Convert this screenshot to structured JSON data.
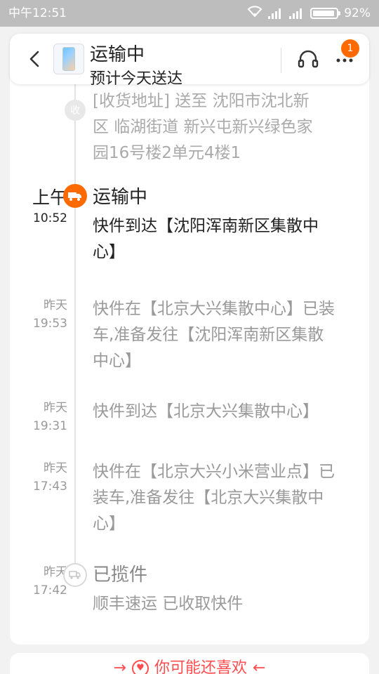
{
  "status_bar": {
    "time": "中午12:51",
    "battery": "92%",
    "battery_level": 0.92
  },
  "header": {
    "title": "运输中",
    "subtitle": "预计今天送达",
    "badge_count": "1",
    "icons": [
      "chevron-left-icon",
      "headset-icon",
      "more-icon"
    ]
  },
  "timeline": {
    "address_fragment": "[收货地址]送至 沈阳市沈北新区 临湖街道 新兴屯新兴绿色家园16号楼2单元4楼1",
    "address_line_top": "[收货地址] 送至 沈阳市沈北新",
    "address_line_2": "区 临湖街道  新兴屯新兴绿色家",
    "address_line_3": "园16号楼2单元4楼1",
    "events": [
      {
        "day": "上午",
        "time": "10:52",
        "title": "运输中",
        "desc_line1": "快件到达【沈阳浑南新区集散中",
        "desc_line2": "心】"
      },
      {
        "day": "昨天",
        "time": "19:53",
        "desc_line1": "快件在【北京大兴集散中心】已装",
        "desc_line2": "车,准备发往【沈阳浑南新区集散",
        "desc_line3": "中心】"
      },
      {
        "day": "昨天",
        "time": "19:31",
        "desc_line1": "快件到达【北京大兴集散中心】"
      },
      {
        "day": "昨天",
        "time": "17:43",
        "desc_line1": "快件在【北京大兴小米营业点】已",
        "desc_line2": "装车,准备发往【北京大兴集散中",
        "desc_line3": "心】"
      },
      {
        "day": "昨天",
        "time": "17:42",
        "title": "已揽件",
        "desc_line1": "顺丰速运 已收取快件"
      }
    ],
    "status_colors": {
      "active": "#ff6a00",
      "inactive": "#cccccc"
    }
  },
  "recommend": {
    "label": "你可能还喜欢",
    "left_arrow": "→",
    "right_arrow": "←"
  }
}
